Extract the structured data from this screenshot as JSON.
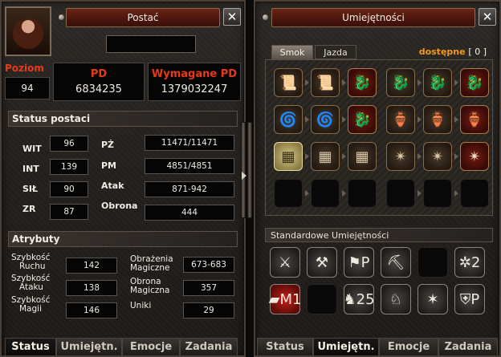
{
  "character_window": {
    "title": "Postać",
    "close_glyph": "✕",
    "name": "",
    "level_label": "Poziom",
    "level": "94",
    "xp_label": "PD",
    "xp": "6834235",
    "req_xp_label": "Wymagane PD",
    "req_xp": "1379032247",
    "status_header": "Status postaci",
    "stats": {
      "wit_label": "WIT",
      "wit": "96",
      "int_label": "INT",
      "int": "139",
      "sil_label": "SIŁ",
      "sil": "90",
      "zr_label": "ZR",
      "zr": "87",
      "pz_label": "PŻ",
      "pz": "11471/11471",
      "pm_label": "PM",
      "pm": "4851/4851",
      "atak_label": "Atak",
      "atak": "871-942",
      "obrona_label": "Obrona",
      "obrona": "444"
    },
    "attributes_header": "Atrybuty",
    "attributes": {
      "move_speed_label1": "Szybkość",
      "move_speed_label2": "Ruchu",
      "move_speed": "142",
      "attack_speed_label1": "Szybkość",
      "attack_speed_label2": "Ataku",
      "attack_speed": "138",
      "magic_speed_label1": "Szybkość",
      "magic_speed_label2": "Magii",
      "magic_speed": "146",
      "magic_dmg_label1": "Obrażenia",
      "magic_dmg_label2": "Magiczne",
      "magic_dmg": "673-683",
      "magic_def_label1": "Obrona",
      "magic_def_label2": "Magiczna",
      "magic_def": "357",
      "dodge_label": "Uniki",
      "dodge": "29"
    },
    "tabs": [
      "Status",
      "Umiejętn.",
      "Emocje",
      "Zadania"
    ],
    "active_tab": "Status"
  },
  "skills_window": {
    "title": "Umiejętności",
    "close_glyph": "✕",
    "subtabs": [
      "Smok",
      "Jazda"
    ],
    "active_subtab": "Smok",
    "available_label": "dostępne",
    "available_value": "[ 0 ]",
    "skill_icons": {
      "scroll": "📜",
      "dragon": "🐉",
      "swirl": "🌀",
      "vase": "🏺",
      "pin": "✴",
      "grid": "▦"
    },
    "standard_header": "Standardowe Umiejętności",
    "standard_badges": {
      "b1": "P",
      "b2": "2",
      "b3": "M1",
      "b4": "25",
      "b5": "P"
    },
    "tabs": [
      "Status",
      "Umiejętn.",
      "Emocje",
      "Zadania"
    ],
    "active_tab": "Umiejętn."
  },
  "colors": {
    "accent_red": "#e83a1a",
    "available_orange": "#f39a1a",
    "title_bar": "#5a1a10"
  }
}
